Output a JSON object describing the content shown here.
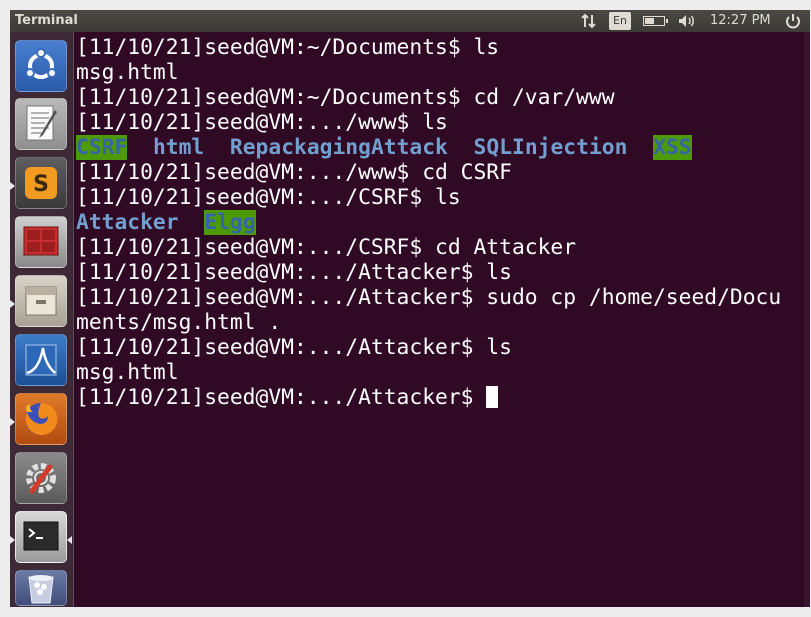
{
  "topbar": {
    "app_title": "Terminal",
    "language": "En",
    "battery_level": 0.5,
    "clock": "12:27 PM",
    "icons": [
      "network-icon",
      "keyboard-language-indicator",
      "battery-icon",
      "volume-icon",
      "power-icon"
    ]
  },
  "launcher": {
    "items": [
      {
        "name": "ubuntu-dash-icon",
        "running": false
      },
      {
        "name": "text-editor-icon",
        "running": false
      },
      {
        "name": "sublime-text-icon",
        "running": true
      },
      {
        "name": "terminal-red-icon",
        "running": false
      },
      {
        "name": "file-manager-icon",
        "running": true
      },
      {
        "name": "wireshark-icon",
        "running": false
      },
      {
        "name": "firefox-icon",
        "running": true
      },
      {
        "name": "system-settings-icon",
        "running": false
      },
      {
        "name": "terminal-icon",
        "running": true,
        "active": true
      },
      {
        "name": "trash-icon",
        "running": false
      }
    ]
  },
  "terminal": {
    "lines": [
      {
        "parts": [
          {
            "text": "[11/10/21]seed@VM:~/Documents$ ls",
            "style": "normal"
          }
        ]
      },
      {
        "parts": [
          {
            "text": "msg.html",
            "style": "normal"
          }
        ]
      },
      {
        "parts": [
          {
            "text": "[11/10/21]seed@VM:~/Documents$ cd /var/www",
            "style": "normal"
          }
        ]
      },
      {
        "parts": [
          {
            "text": "[11/10/21]seed@VM:.../www$ ls",
            "style": "normal"
          }
        ]
      },
      {
        "parts": [
          {
            "text": "CSRF",
            "style": "hl"
          },
          {
            "text": "  ",
            "style": "normal"
          },
          {
            "text": "html",
            "style": "dir"
          },
          {
            "text": "  ",
            "style": "normal"
          },
          {
            "text": "RepackagingAttack",
            "style": "dir"
          },
          {
            "text": "  ",
            "style": "normal"
          },
          {
            "text": "SQLInjection",
            "style": "dir"
          },
          {
            "text": "  ",
            "style": "normal"
          },
          {
            "text": "XSS",
            "style": "hl"
          }
        ]
      },
      {
        "parts": [
          {
            "text": "[11/10/21]seed@VM:.../www$ cd CSRF",
            "style": "normal"
          }
        ]
      },
      {
        "parts": [
          {
            "text": "[11/10/21]seed@VM:.../CSRF$ ls",
            "style": "normal"
          }
        ]
      },
      {
        "parts": [
          {
            "text": "Attacker",
            "style": "dir"
          },
          {
            "text": "  ",
            "style": "normal"
          },
          {
            "text": "Elgg",
            "style": "hl"
          }
        ]
      },
      {
        "parts": [
          {
            "text": "[11/10/21]seed@VM:.../CSRF$ cd Attacker",
            "style": "normal"
          }
        ]
      },
      {
        "parts": [
          {
            "text": "[11/10/21]seed@VM:.../Attacker$ ls",
            "style": "normal"
          }
        ]
      },
      {
        "parts": [
          {
            "text": "[11/10/21]seed@VM:.../Attacker$ sudo cp /home/seed/Docu",
            "style": "normal"
          }
        ]
      },
      {
        "parts": [
          {
            "text": "ments/msg.html .",
            "style": "normal"
          }
        ]
      },
      {
        "parts": [
          {
            "text": "[11/10/21]seed@VM:.../Attacker$ ls",
            "style": "normal"
          }
        ]
      },
      {
        "parts": [
          {
            "text": "msg.html",
            "style": "normal"
          }
        ]
      },
      {
        "parts": [
          {
            "text": "[11/10/21]seed@VM:.../Attacker$ ",
            "style": "normal"
          }
        ],
        "cursor": true
      }
    ]
  }
}
